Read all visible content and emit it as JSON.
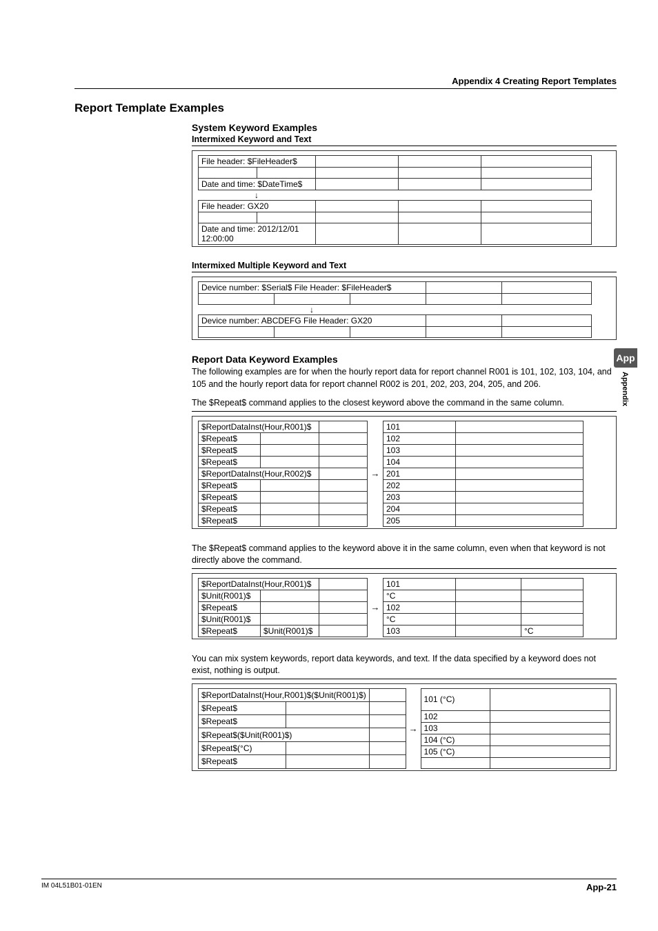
{
  "header": {
    "breadcrumb": "Appendix 4 Creating Report Templates"
  },
  "title": "Report Template Examples",
  "s1": {
    "heading": "System Keyword Examples",
    "sub1": "Intermixed Keyword and Text",
    "ex1_src_r1": "File header: $FileHeader$",
    "ex1_src_r2": "Date and time: $DateTime$",
    "ex1_out_r1": "File header: GX20",
    "ex1_out_r2": "Date and time: 2012/12/01 12:00:00",
    "sub2": "Intermixed Multiple Keyword and Text",
    "ex2_src": "Device number: $Serial$ File Header: $FileHeader$",
    "ex2_out": "Device number: ABCDEFG File Header: GX20"
  },
  "s2": {
    "heading": "Report Data Keyword Examples",
    "p1": "The following examples are for when the hourly report data for report channel R001 is 101, 102, 103, 104, and 105 and the hourly report data for report channel R002 is 201, 202, 203, 204, 205, and 206.",
    "p2": "The $Repeat$ command applies to the closest keyword above the command in the same column.",
    "ex3_src": {
      "r0": "$ReportDataInst(Hour,R001)$",
      "r1": "$Repeat$",
      "r2": "$Repeat$",
      "r3": "$Repeat$",
      "r4": "$ReportDataInst(Hour,R002)$",
      "r5": "$Repeat$",
      "r6": "$Repeat$",
      "r7": "$Repeat$",
      "r8": "$Repeat$"
    },
    "ex3_out": {
      "r0": "101",
      "r1": "102",
      "r2": "103",
      "r3": "104",
      "r4": "201",
      "r5": "202",
      "r6": "203",
      "r7": "204",
      "r8": "205"
    },
    "p3": "The $Repeat$ command applies to the keyword above it in the same column, even when that keyword is not directly above the command.",
    "ex4_src": {
      "r0c0": "$ReportDataInst(Hour,R001)$",
      "r1c0": "$Unit(R001)$",
      "r2c0": "$Repeat$",
      "r3c0": "$Unit(R001)$",
      "r4c0": "$Repeat$",
      "r4c1": "$Unit(R001)$"
    },
    "ex4_out": {
      "r0c0": "101",
      "r1c0": "°C",
      "r2c0": "102",
      "r3c0": "°C",
      "r4c0": "103",
      "r4c1": "°C"
    },
    "p4": "You can mix system keywords, report data keywords, and text. If the data specified by a keyword does not exist, nothing is output.",
    "ex5_src": {
      "r0": "$ReportDataInst(Hour,R001)$($Unit(R001)$)",
      "r1": "$Repeat$",
      "r2": "$Repeat$",
      "r3": "$Repeat$($Unit(R001)$)",
      "r4": "$Repeat$(°C)",
      "r5": "$Repeat$"
    },
    "ex5_out": {
      "r0": "101 (°C)",
      "r1": "102",
      "r2": "103",
      "r3": "104 (°C)",
      "r4": "105 (°C)",
      "r5": ""
    }
  },
  "sidebar": {
    "badge": "App",
    "label": "Appendix"
  },
  "footer": {
    "left": "IM 04L51B01-01EN",
    "right": "App-21"
  },
  "arrow": "→",
  "darrow": "↓"
}
